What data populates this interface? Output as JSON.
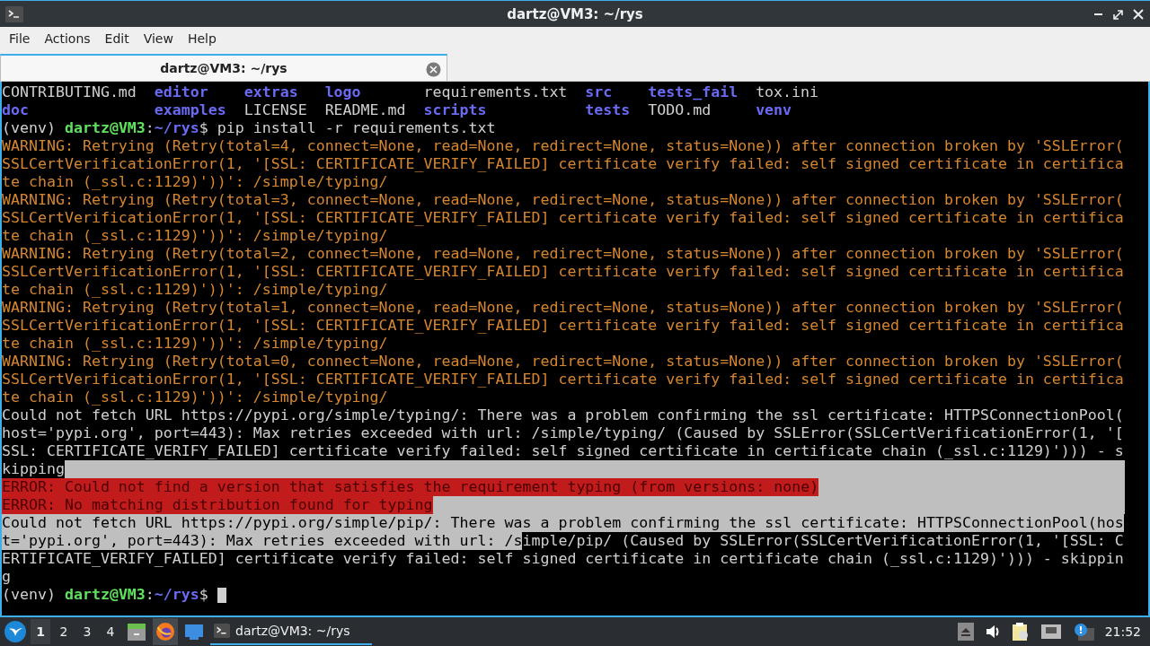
{
  "window": {
    "title": "dartz@VM3: ~/rys"
  },
  "menu": [
    "File",
    "Actions",
    "Edit",
    "View",
    "Help"
  ],
  "tabs": [
    {
      "label": "dartz@VM3: ~/rys",
      "selected": true
    }
  ],
  "terminal": {
    "lines": [
      {
        "kind": "listing",
        "entries": [
          {
            "text": "CONTRIBUTING.md",
            "kind": "file"
          },
          {
            "text": "editor",
            "kind": "dir"
          },
          {
            "text": "extras",
            "kind": "dir"
          },
          {
            "text": "logo",
            "kind": "dir"
          },
          {
            "text": "requirements.txt",
            "kind": "file"
          },
          {
            "text": "src",
            "kind": "dir"
          },
          {
            "text": "tests_fail",
            "kind": "dir"
          },
          {
            "text": "tox.ini",
            "kind": "file"
          }
        ]
      },
      {
        "kind": "listing",
        "entries": [
          {
            "text": "doc",
            "kind": "dir"
          },
          {
            "text": "examples",
            "kind": "dir"
          },
          {
            "text": "LICENSE",
            "kind": "file"
          },
          {
            "text": "README.md",
            "kind": "file"
          },
          {
            "text": "scripts",
            "kind": "dir"
          },
          {
            "text": "tests",
            "kind": "dir"
          },
          {
            "text": "TODO.md",
            "kind": "file"
          },
          {
            "text": "venv",
            "kind": "dir"
          }
        ]
      },
      {
        "kind": "text",
        "selected_tail": false,
        "cursor": false,
        "segments": [
          {
            "text": "(venv) ",
            "kind": "plain"
          },
          {
            "text": "dartz@VM3",
            "kind": "user"
          },
          {
            "text": ":",
            "kind": "plain"
          },
          {
            "text": "~/rys",
            "kind": "path"
          },
          {
            "text": "$ pip install -r requirements.txt",
            "kind": "plain"
          }
        ]
      },
      {
        "kind": "text",
        "selected_tail": false,
        "cursor": false,
        "segments": [
          {
            "text": "WARNING: Retrying (Retry(total=4, connect=None, read=None, redirect=None, status=None)) after connection broken by 'SSLError(",
            "kind": "warning"
          }
        ]
      },
      {
        "kind": "text",
        "selected_tail": false,
        "cursor": false,
        "segments": [
          {
            "text": "SSLCertVerificationError(1, '[SSL: CERTIFICATE_VERIFY_FAILED] certificate verify failed: self signed certificate in certifica",
            "kind": "warning"
          }
        ]
      },
      {
        "kind": "text",
        "selected_tail": false,
        "cursor": false,
        "segments": [
          {
            "text": "te chain (_ssl.c:1129)'))': /simple/typing/",
            "kind": "warning"
          }
        ]
      },
      {
        "kind": "text",
        "selected_tail": false,
        "cursor": false,
        "segments": [
          {
            "text": "WARNING: Retrying (Retry(total=3, connect=None, read=None, redirect=None, status=None)) after connection broken by 'SSLError(",
            "kind": "warning"
          }
        ]
      },
      {
        "kind": "text",
        "selected_tail": false,
        "cursor": false,
        "segments": [
          {
            "text": "SSLCertVerificationError(1, '[SSL: CERTIFICATE_VERIFY_FAILED] certificate verify failed: self signed certificate in certifica",
            "kind": "warning"
          }
        ]
      },
      {
        "kind": "text",
        "selected_tail": false,
        "cursor": false,
        "segments": [
          {
            "text": "te chain (_ssl.c:1129)'))': /simple/typing/",
            "kind": "warning"
          }
        ]
      },
      {
        "kind": "text",
        "selected_tail": false,
        "cursor": false,
        "segments": [
          {
            "text": "WARNING: Retrying (Retry(total=2, connect=None, read=None, redirect=None, status=None)) after connection broken by 'SSLError(",
            "kind": "warning"
          }
        ]
      },
      {
        "kind": "text",
        "selected_tail": false,
        "cursor": false,
        "segments": [
          {
            "text": "SSLCertVerificationError(1, '[SSL: CERTIFICATE_VERIFY_FAILED] certificate verify failed: self signed certificate in certifica",
            "kind": "warning"
          }
        ]
      },
      {
        "kind": "text",
        "selected_tail": false,
        "cursor": false,
        "segments": [
          {
            "text": "te chain (_ssl.c:1129)'))': /simple/typing/",
            "kind": "warning"
          }
        ]
      },
      {
        "kind": "text",
        "selected_tail": false,
        "cursor": false,
        "segments": [
          {
            "text": "WARNING: Retrying (Retry(total=1, connect=None, read=None, redirect=None, status=None)) after connection broken by 'SSLError(",
            "kind": "warning"
          }
        ]
      },
      {
        "kind": "text",
        "selected_tail": false,
        "cursor": false,
        "segments": [
          {
            "text": "SSLCertVerificationError(1, '[SSL: CERTIFICATE_VERIFY_FAILED] certificate verify failed: self signed certificate in certifica",
            "kind": "warning"
          }
        ]
      },
      {
        "kind": "text",
        "selected_tail": false,
        "cursor": false,
        "segments": [
          {
            "text": "te chain (_ssl.c:1129)'))': /simple/typing/",
            "kind": "warning"
          }
        ]
      },
      {
        "kind": "text",
        "selected_tail": false,
        "cursor": false,
        "segments": [
          {
            "text": "WARNING: Retrying (Retry(total=0, connect=None, read=None, redirect=None, status=None)) after connection broken by 'SSLError(",
            "kind": "warning"
          }
        ]
      },
      {
        "kind": "text",
        "selected_tail": false,
        "cursor": false,
        "segments": [
          {
            "text": "SSLCertVerificationError(1, '[SSL: CERTIFICATE_VERIFY_FAILED] certificate verify failed: self signed certificate in certifica",
            "kind": "warning"
          }
        ]
      },
      {
        "kind": "text",
        "selected_tail": false,
        "cursor": false,
        "segments": [
          {
            "text": "te chain (_ssl.c:1129)'))': /simple/typing/",
            "kind": "warning"
          }
        ]
      },
      {
        "kind": "text",
        "selected_tail": false,
        "cursor": false,
        "segments": [
          {
            "text": "Could not fetch URL https://pypi.org/simple/typing/: There was a problem confirming the ssl certificate: HTTPSConnectionPool(",
            "kind": "plain"
          }
        ]
      },
      {
        "kind": "text",
        "selected_tail": false,
        "cursor": false,
        "segments": [
          {
            "text": "host='pypi.org', port=443): Max retries exceeded with url: /simple/typing/ (Caused by SSLError(SSLCertVerificationError(1, '[",
            "kind": "plain"
          }
        ]
      },
      {
        "kind": "text",
        "selected_tail": false,
        "cursor": false,
        "segments": [
          {
            "text": "SSL: CERTIFICATE_VERIFY_FAILED] certificate verify failed: self signed certificate in certificate chain (_ssl.c:1129)'))) - s",
            "kind": "plain"
          }
        ]
      },
      {
        "kind": "text",
        "selected_tail": true,
        "cursor": false,
        "segments": [
          {
            "text": "kipping",
            "kind": "plain"
          }
        ]
      },
      {
        "kind": "text",
        "selected_tail": true,
        "cursor": false,
        "segments": [
          {
            "text": "ERROR: Could not find a version that satisfies the requirement typing (from versions: none)",
            "kind": "error"
          }
        ]
      },
      {
        "kind": "text",
        "selected_tail": true,
        "cursor": false,
        "segments": [
          {
            "text": "ERROR: No matching distribution found for typing",
            "kind": "error"
          }
        ]
      },
      {
        "kind": "text",
        "selected_tail": false,
        "cursor": false,
        "segments": [
          {
            "text": "Could not fetch URL https://pypi.org/simple/pip/: There was a problem confirming the ssl certificate: HTTPSConnectionPool(hos",
            "kind": "selected"
          }
        ]
      },
      {
        "kind": "text",
        "selected_tail": false,
        "cursor": false,
        "segments": [
          {
            "text": "t='pypi.org', port=443): Max retries exceeded with url: /s",
            "kind": "selected"
          },
          {
            "text": "imple/pip/ (Caused by SSLError(SSLCertVerificationError(1, '[SSL: C",
            "kind": "plain"
          }
        ]
      },
      {
        "kind": "text",
        "selected_tail": false,
        "cursor": false,
        "segments": [
          {
            "text": "ERTIFICATE_VERIFY_FAILED] certificate verify failed: self signed certificate in certificate chain (_ssl.c:1129)'))) - skippin",
            "kind": "plain"
          }
        ]
      },
      {
        "kind": "text",
        "selected_tail": false,
        "cursor": false,
        "segments": [
          {
            "text": "g",
            "kind": "plain"
          }
        ]
      },
      {
        "kind": "text",
        "selected_tail": false,
        "cursor": true,
        "segments": [
          {
            "text": "(venv) ",
            "kind": "plain"
          },
          {
            "text": "dartz@VM3",
            "kind": "user"
          },
          {
            "text": ":",
            "kind": "plain"
          },
          {
            "text": "~/rys",
            "kind": "path"
          },
          {
            "text": "$ ",
            "kind": "plain"
          }
        ]
      }
    ]
  },
  "taskbar": {
    "workspaces": [
      {
        "label": "1",
        "selected": true
      },
      {
        "label": "2",
        "selected": false
      },
      {
        "label": "3",
        "selected": false
      },
      {
        "label": "4",
        "selected": false
      }
    ],
    "tasks": [
      {
        "label": "dartz@VM3: ~/rys",
        "selected": true
      }
    ],
    "clock": "21:52"
  }
}
